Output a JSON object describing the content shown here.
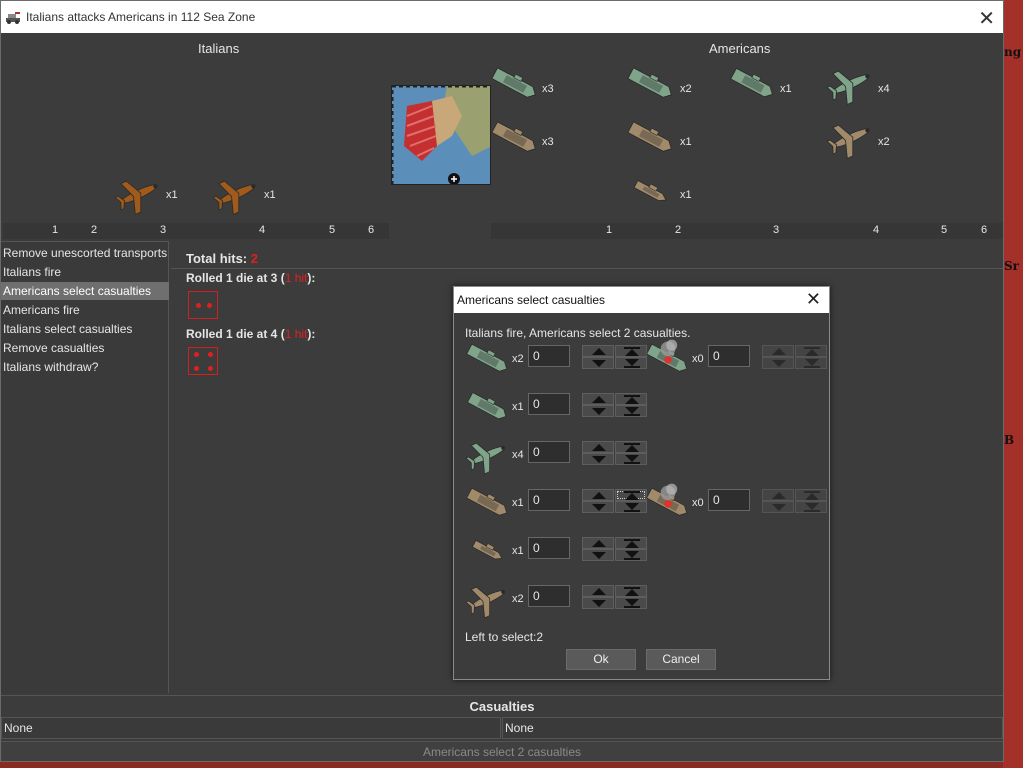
{
  "window": {
    "title": "Italians attacks Americans in 112 Sea Zone",
    "close_glyph": "✕"
  },
  "map_labels": [
    "ng",
    "Sr",
    "B"
  ],
  "attacker": {
    "name": "Italians",
    "units": [
      {
        "type": "fighter",
        "color": "#a05a1c",
        "count": "x1"
      },
      {
        "type": "bomber",
        "color": "#a05a1c",
        "count": "x1"
      }
    ],
    "die_labels": [
      "1",
      "2",
      "3",
      "4",
      "5",
      "6"
    ]
  },
  "defender": {
    "name": "Americans",
    "units": [
      {
        "type": "transport",
        "color": "#7fa48a",
        "count": "x3"
      },
      {
        "type": "transport",
        "color": "#a08a6a",
        "count": "x3"
      },
      {
        "type": "carrier",
        "color": "#7fa48a",
        "count": "x2"
      },
      {
        "type": "battleship",
        "color": "#7fa48a",
        "count": "x1"
      },
      {
        "type": "fighter",
        "color": "#7fa48a",
        "count": "x4"
      },
      {
        "type": "carrier",
        "color": "#a08a6a",
        "count": "x1"
      },
      {
        "type": "fighter",
        "color": "#a08a6a",
        "count": "x2"
      },
      {
        "type": "destroyer",
        "color": "#a08a6a",
        "count": "x1"
      }
    ],
    "die_labels": [
      "1",
      "2",
      "3",
      "4",
      "5",
      "6"
    ]
  },
  "steps": [
    {
      "label": "Remove unescorted transports",
      "selected": false
    },
    {
      "label": "Italians fire",
      "selected": false
    },
    {
      "label": "Americans select casualties",
      "selected": true
    },
    {
      "label": "Americans fire",
      "selected": false
    },
    {
      "label": "Italians select casualties",
      "selected": false
    },
    {
      "label": "Remove casualties",
      "selected": false
    },
    {
      "label": "Italians withdraw?",
      "selected": false
    }
  ],
  "hits": {
    "label": "Total hits:",
    "total": "2",
    "rolls": [
      {
        "prefix": "Rolled 1 die at 3 (",
        "hit": "1 hit",
        "suffix": "):",
        "die_value": 2
      },
      {
        "prefix": "Rolled 1 die at 4 (",
        "hit": "1 hit",
        "suffix": "):",
        "die_value": 4
      }
    ]
  },
  "casualties": {
    "title": "Casualties",
    "left": "None",
    "right": "None"
  },
  "status": "Americans select 2 casualties",
  "dialog": {
    "title": "Americans select casualties",
    "close_glyph": "✕",
    "message": "Italians fire,  Americans select 2 casualties.",
    "rows": [
      {
        "type": "carrier",
        "color": "#7fa48a",
        "count": "x2",
        "value": "0",
        "damaged": {
          "type": "carrier",
          "color": "#7fa48a",
          "count": "x0",
          "value": "0"
        }
      },
      {
        "type": "battleship",
        "color": "#7fa48a",
        "count": "x1",
        "value": "0"
      },
      {
        "type": "fighter",
        "color": "#7fa48a",
        "count": "x4",
        "value": "0"
      },
      {
        "type": "carrier",
        "color": "#a08a6a",
        "count": "x1",
        "value": "0",
        "damaged": {
          "type": "carrier",
          "color": "#a08a6a",
          "count": "x0",
          "value": "0"
        }
      },
      {
        "type": "destroyer",
        "color": "#a08a6a",
        "count": "x1",
        "value": "0"
      },
      {
        "type": "fighter",
        "color": "#a08a6a",
        "count": "x2",
        "value": "0"
      }
    ],
    "left_to_select": "Left to select:2",
    "ok_label": "Ok",
    "cancel_label": "Cancel"
  }
}
